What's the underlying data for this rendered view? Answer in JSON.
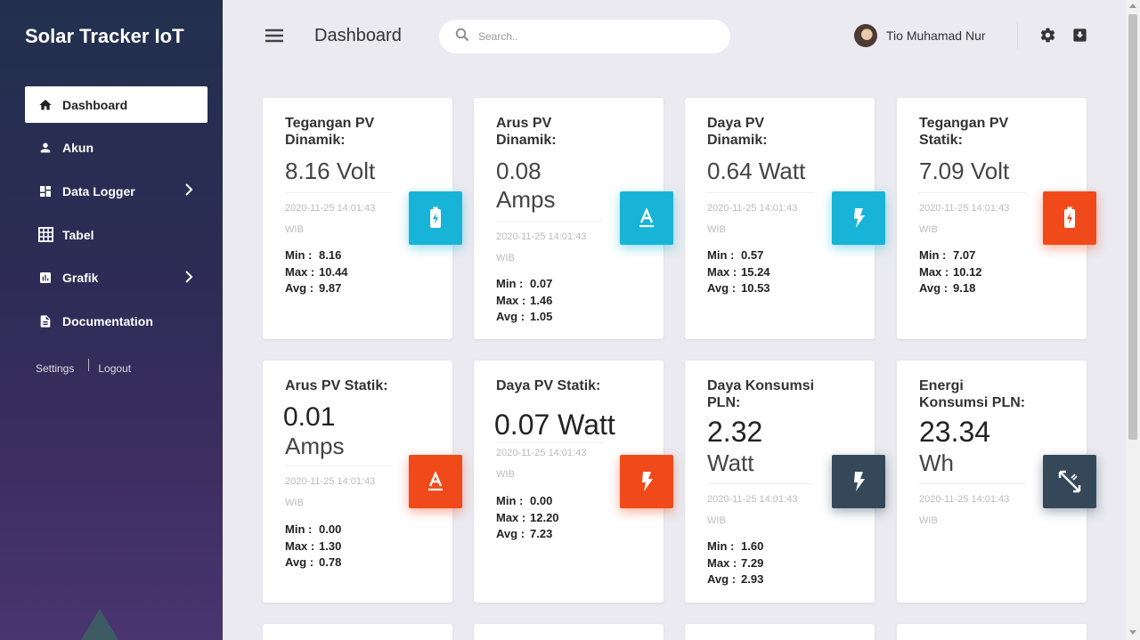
{
  "sidebar": {
    "brand": "Solar Tracker IoT",
    "items": [
      {
        "label": "Dashboard",
        "icon": "home-icon",
        "active": true
      },
      {
        "label": "Akun",
        "icon": "person-icon"
      },
      {
        "label": "Data Logger",
        "icon": "dashboard-icon",
        "has_children": true
      },
      {
        "label": "Tabel",
        "icon": "grid-icon"
      },
      {
        "label": "Grafik",
        "icon": "chart-icon",
        "has_children": true
      },
      {
        "label": "Documentation",
        "icon": "document-icon"
      }
    ],
    "settings_label": "Settings",
    "logout_label": "Logout"
  },
  "header": {
    "title": "Dashboard",
    "search_placeholder": "Search..",
    "user_name": "Tio Muhamad Nur"
  },
  "cards": [
    {
      "title": "Tegangan PV Dinamik:",
      "value_line1": "8.16 Volt",
      "value_line2": "",
      "time": "2020-11-25 14:01:43",
      "tz": "WIB",
      "min": "8.16",
      "max": "10.44",
      "avg": "9.87",
      "icon": "battery-charging-icon",
      "color": "#17b4d8"
    },
    {
      "title": "Arus PV Dinamik:",
      "value_line1": "0.08",
      "value_line2": "Amps",
      "time": "2020-11-25 14:01:43",
      "tz": "WIB",
      "min": "0.07",
      "max": "1.46",
      "avg": "1.05",
      "icon": "current-icon",
      "color": "#17b4d8"
    },
    {
      "title": "Daya PV Dinamik:",
      "value_line1": "0.64 Watt",
      "value_line2": "",
      "time": "2020-11-25 14:01:43",
      "tz": "WIB",
      "min": "0.57",
      "max": "15.24",
      "avg": "10.53",
      "icon": "bolt-icon",
      "color": "#17b4d8"
    },
    {
      "title": "Tegangan PV Statik:",
      "value_line1": "7.09 Volt",
      "value_line2": "",
      "time": "2020-11-25 14:01:43",
      "tz": "WIB",
      "min": "7.07",
      "max": "10.12",
      "avg": "9.18",
      "icon": "battery-charging-icon",
      "color": "#f04a1b"
    },
    {
      "title": "Arus PV Statik:",
      "value_line1": "0.01",
      "value_line2": "Amps",
      "time": "2020-11-25 14:01:43",
      "tz": "WIB",
      "min": "0.00",
      "max": "1.30",
      "avg": "0.78",
      "icon": "current-icon",
      "color": "#f04a1b"
    },
    {
      "title": "Daya PV Statik:",
      "value_line1": "0.07 Watt",
      "value_line2": "",
      "time": "2020-11-25 14:01:43",
      "tz": "WIB",
      "min": "0.00",
      "max": "12.20",
      "avg": "7.23",
      "icon": "bolt-icon",
      "color": "#f04a1b"
    },
    {
      "title": "Daya Konsumsi PLN:",
      "value_line1": "2.32",
      "value_line2": "Watt",
      "time": "2020-11-25 14:01:43",
      "tz": "WIB",
      "min": "1.60",
      "max": "7.29",
      "avg": "2.93",
      "icon": "bolt-icon",
      "color": "#34485a"
    },
    {
      "title": "Energi Konsumsi PLN:",
      "value_line1": "23.34",
      "value_line2": "Wh",
      "time": "2020-11-25 14:01:43",
      "tz": "WIB",
      "icon": "expand-diagonal-icon",
      "color": "#34485a"
    }
  ],
  "labels": {
    "min": "Min :",
    "max": "Max :",
    "avg": "Avg :"
  }
}
